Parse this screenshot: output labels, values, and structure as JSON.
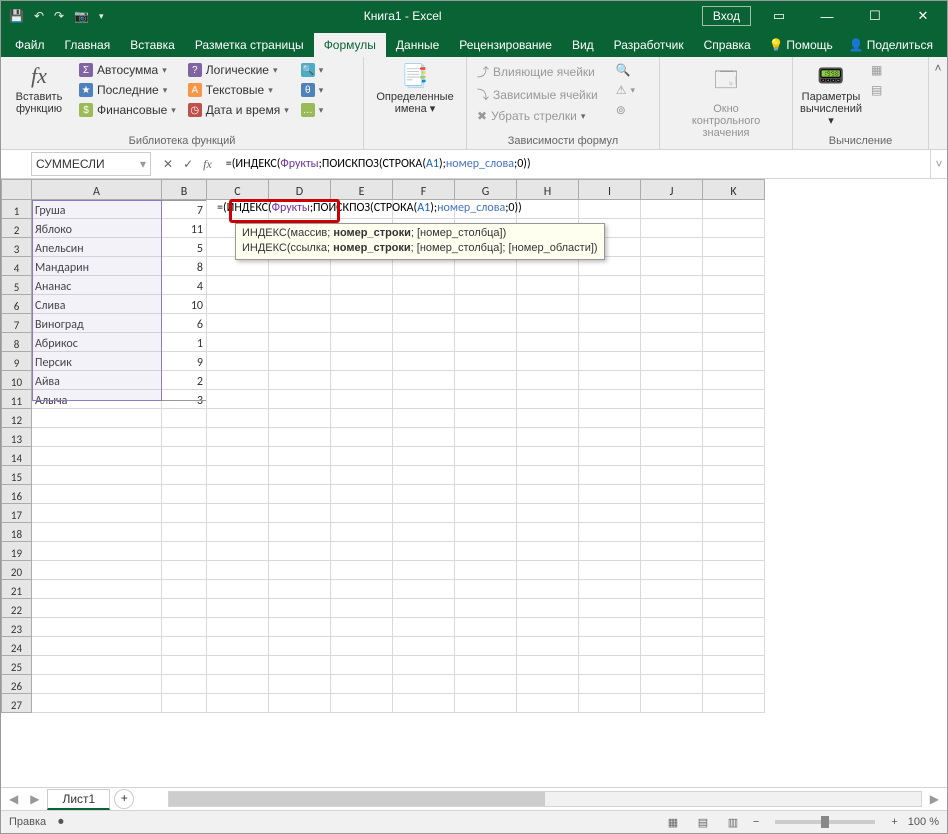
{
  "titlebar": {
    "title": "Книга1  -  Excel",
    "login": "Вход"
  },
  "tabs": {
    "file": "Файл",
    "items": [
      "Главная",
      "Вставка",
      "Разметка страницы",
      "Формулы",
      "Данные",
      "Рецензирование",
      "Вид",
      "Разработчик",
      "Справка"
    ],
    "active_index": 3,
    "help": "Помощь",
    "share": "Поделиться"
  },
  "ribbon": {
    "group1": {
      "insert_fn_line1": "Вставить",
      "insert_fn_line2": "функцию",
      "autosum": "Автосумма",
      "recent": "Последние",
      "financial": "Финансовые",
      "logical": "Логические",
      "text": "Текстовые",
      "datetime": "Дата и время",
      "label": "Библиотека функций"
    },
    "group2": {
      "defined_line1": "Определенные",
      "defined_line2": "имена",
      "label": ""
    },
    "group3": {
      "trace_prec": "Влияющие ячейки",
      "trace_dep": "Зависимые ячейки",
      "remove_arrows": "Убрать стрелки",
      "label": "Зависимости формул"
    },
    "group4": {
      "watch_line1": "Окно контрольного",
      "watch_line2": "значения",
      "label": ""
    },
    "group5": {
      "calc_line1": "Параметры",
      "calc_line2": "вычислений",
      "label": "Вычисление"
    }
  },
  "namebox": "СУММЕСЛИ",
  "formula_bar": "=(ИНДЕКС(Фрукты;ПОИСКПОЗ(СТРОКА(A1);номер_слова;0))",
  "formula_parts": {
    "p1": "=(ИНДЕКС(",
    "p2": "Фрукты",
    "p3": ";П",
    "p4": "ОИСКПОЗ(СТРОКА(",
    "p5": "A1",
    "p6": ");",
    "p7": "номер_слова",
    "p8": ";0))"
  },
  "grid": {
    "cols": [
      "A",
      "B",
      "C",
      "D",
      "E",
      "F",
      "G",
      "H",
      "I",
      "J",
      "K"
    ],
    "rows": [
      {
        "n": 1,
        "a": "Груша",
        "b": "7"
      },
      {
        "n": 2,
        "a": "Яблоко",
        "b": "11"
      },
      {
        "n": 3,
        "a": "Апельсин",
        "b": "5"
      },
      {
        "n": 4,
        "a": "Мандарин",
        "b": "8"
      },
      {
        "n": 5,
        "a": "Ананас",
        "b": "4"
      },
      {
        "n": 6,
        "a": "Слива",
        "b": "10"
      },
      {
        "n": 7,
        "a": "Виноград",
        "b": "6"
      },
      {
        "n": 8,
        "a": "Абрикос",
        "b": "1"
      },
      {
        "n": 9,
        "a": "Персик",
        "b": "9"
      },
      {
        "n": 10,
        "a": "Айва",
        "b": "2"
      },
      {
        "n": 11,
        "a": "Алыча",
        "b": "3"
      }
    ],
    "blank_rows": [
      12,
      13,
      14,
      15,
      16,
      17,
      18,
      19,
      20,
      21,
      22,
      23,
      24,
      25,
      26,
      27
    ]
  },
  "tooltip": {
    "line1_a": "ИНДЕКС(массив; ",
    "line1_b": "номер_строки",
    "line1_c": "; [номер_столбца])",
    "line2_a": "ИНДЕКС(ссылка; ",
    "line2_b": "номер_строки",
    "line2_c": "; [номер_столбца]; [номер_области])"
  },
  "sheet": "Лист1",
  "status": {
    "mode": "Правка",
    "zoom": "100 %"
  }
}
